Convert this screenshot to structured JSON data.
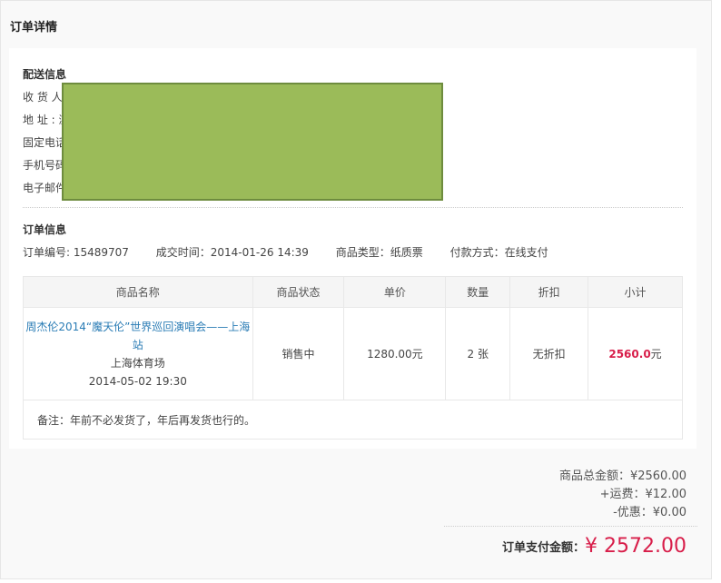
{
  "page_title": "订单详情",
  "delivery": {
    "title": "配送信息",
    "labels": [
      "收 货 人",
      "地 址 : 浏",
      "固定电话",
      "手机号码",
      "电子邮件"
    ]
  },
  "order_info": {
    "title": "订单信息",
    "number": "订单编号: 15489707",
    "time": "成交时间：2014-01-26 14:39",
    "type": "商品类型：纸质票",
    "payment": "付款方式：在线支付"
  },
  "table": {
    "headers": [
      "商品名称",
      "商品状态",
      "单价",
      "数量",
      "折扣",
      "小计"
    ],
    "row": {
      "product_name": "周杰伦2014“魔天伦”世界巡回演唱会——上海站",
      "venue": "上海体育场",
      "datetime": "2014-05-02 19:30",
      "status": "销售中",
      "unit_price": "1280.00元",
      "quantity": "2 张",
      "discount": "无折扣",
      "subtotal_number": "2560.0",
      "subtotal_unit": "元"
    },
    "remark": "备注：年前不必发货了，年后再发货也行的。"
  },
  "summary": {
    "goods_total": "商品总金额：¥2560.00",
    "shipping": "+运费：¥12.00",
    "discount": "-优惠：¥0.00",
    "total_label": "订单支付金额：",
    "total_amount": "¥ 2572.00"
  },
  "colors": {
    "link": "#2a7cb5",
    "accent": "#d81e4a",
    "redaction": "#9bbb59"
  }
}
